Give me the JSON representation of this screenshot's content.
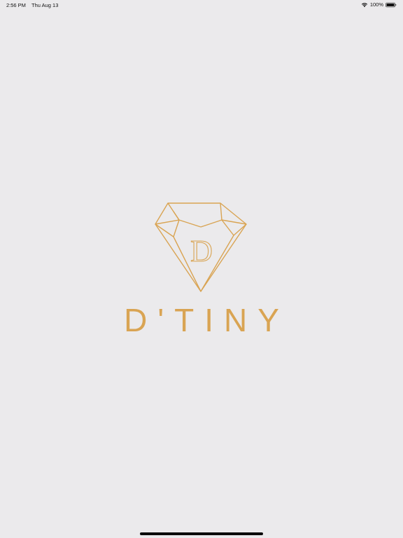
{
  "status_bar": {
    "time": "2:56 PM",
    "date": "Thu Aug 13",
    "battery": "100%",
    "battery_level": 1.0,
    "icons": [
      "wifi-icon",
      "battery-icon"
    ]
  },
  "brand": {
    "name": "D'TINY",
    "emblem_letter": "D",
    "color": "#d9a453"
  },
  "colors": {
    "background": "#ebeaec",
    "accent": "#d9a453"
  }
}
